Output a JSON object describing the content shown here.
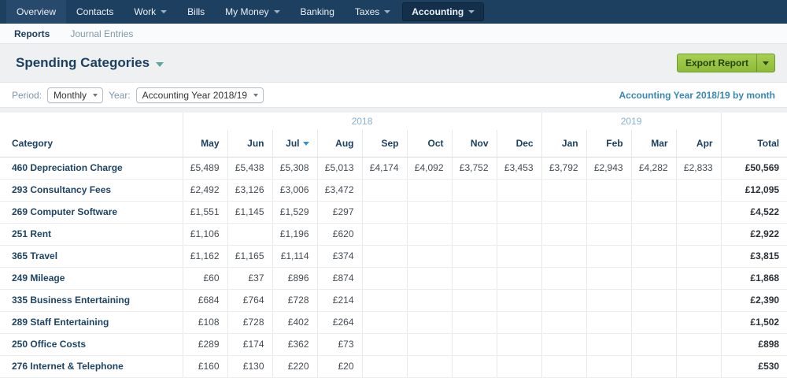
{
  "nav": {
    "items": [
      {
        "label": "Overview",
        "active": true,
        "dropdown": false
      },
      {
        "label": "Contacts",
        "dropdown": false
      },
      {
        "label": "Work",
        "dropdown": true
      },
      {
        "label": "Bills",
        "dropdown": false
      },
      {
        "label": "My Money",
        "dropdown": true
      },
      {
        "label": "Banking",
        "dropdown": false
      },
      {
        "label": "Taxes",
        "dropdown": true
      },
      {
        "label": "Accounting",
        "dropdown": true,
        "selected": true
      }
    ]
  },
  "subnav": {
    "items": [
      {
        "label": "Reports",
        "active": true
      },
      {
        "label": "Journal Entries",
        "active": false
      }
    ]
  },
  "header": {
    "title": "Spending Categories",
    "export_label": "Export Report"
  },
  "filters": {
    "period_label": "Period:",
    "period_value": "Monthly",
    "year_label": "Year:",
    "year_value": "Accounting Year 2018/19",
    "summary": "Accounting Year 2018/19 by month"
  },
  "table": {
    "category_label": "Category",
    "total_label": "Total",
    "year_groups": [
      {
        "label": "2018",
        "span": 8
      },
      {
        "label": "2019",
        "span": 4
      }
    ],
    "months": [
      "May",
      "Jun",
      "Jul",
      "Aug",
      "Sep",
      "Oct",
      "Nov",
      "Dec",
      "Jan",
      "Feb",
      "Mar",
      "Apr"
    ],
    "sorted_column": "Jul",
    "rows": [
      {
        "category": "460 Depreciation Charge",
        "values": [
          "£5,489",
          "£5,438",
          "£5,308",
          "£5,013",
          "£4,174",
          "£4,092",
          "£3,752",
          "£3,453",
          "£3,792",
          "£2,943",
          "£4,282",
          "£2,833"
        ],
        "total": "£50,569"
      },
      {
        "category": "293 Consultancy Fees",
        "values": [
          "£2,492",
          "£3,126",
          "£3,006",
          "£3,472",
          "",
          "",
          "",
          "",
          "",
          "",
          "",
          ""
        ],
        "total": "£12,095"
      },
      {
        "category": "269 Computer Software",
        "values": [
          "£1,551",
          "£1,145",
          "£1,529",
          "£297",
          "",
          "",
          "",
          "",
          "",
          "",
          "",
          ""
        ],
        "total": "£4,522"
      },
      {
        "category": "251 Rent",
        "values": [
          "£1,106",
          "",
          "£1,196",
          "£620",
          "",
          "",
          "",
          "",
          "",
          "",
          "",
          ""
        ],
        "total": "£2,922"
      },
      {
        "category": "365 Travel",
        "values": [
          "£1,162",
          "£1,165",
          "£1,114",
          "£374",
          "",
          "",
          "",
          "",
          "",
          "",
          "",
          ""
        ],
        "total": "£3,815"
      },
      {
        "category": "249 Mileage",
        "values": [
          "£60",
          "£37",
          "£896",
          "£874",
          "",
          "",
          "",
          "",
          "",
          "",
          "",
          ""
        ],
        "total": "£1,868"
      },
      {
        "category": "335 Business Entertaining",
        "values": [
          "£684",
          "£764",
          "£728",
          "£214",
          "",
          "",
          "",
          "",
          "",
          "",
          "",
          ""
        ],
        "total": "£2,390"
      },
      {
        "category": "289 Staff Entertaining",
        "values": [
          "£108",
          "£728",
          "£402",
          "£264",
          "",
          "",
          "",
          "",
          "",
          "",
          "",
          ""
        ],
        "total": "£1,502"
      },
      {
        "category": "250 Office Costs",
        "values": [
          "£289",
          "£174",
          "£362",
          "£73",
          "",
          "",
          "",
          "",
          "",
          "",
          "",
          ""
        ],
        "total": "£898"
      },
      {
        "category": "276 Internet & Telephone",
        "values": [
          "£160",
          "£130",
          "£220",
          "£20",
          "",
          "",
          "",
          "",
          "",
          "",
          "",
          ""
        ],
        "total": "£530"
      }
    ]
  }
}
